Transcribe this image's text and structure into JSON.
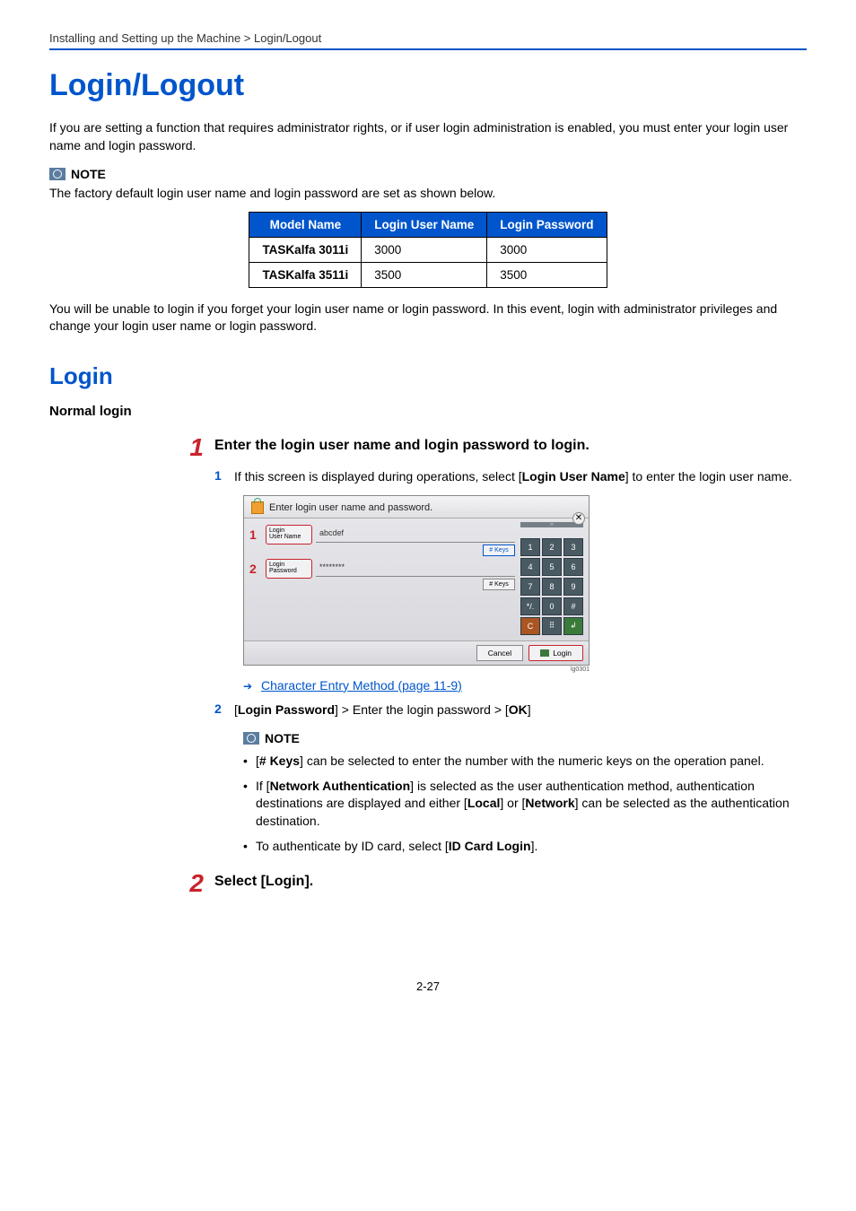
{
  "breadcrumb": "Installing and Setting up the Machine > Login/Logout",
  "h1": "Login/Logout",
  "intro": "If you are setting a function that requires administrator rights, or if user login administration is enabled, you must enter your login user name and login password.",
  "note_label": "NOTE",
  "note1_text": "The factory default login user name and login password are set as shown below.",
  "table": {
    "headers": [
      "Model Name",
      "Login User Name",
      "Login Password"
    ],
    "rows": [
      [
        "TASKalfa 3011i",
        "3000",
        "3000"
      ],
      [
        "TASKalfa 3511i",
        "3500",
        "3500"
      ]
    ]
  },
  "after_table": "You will be unable to login if you forget your login user name or login password. In this event, login with administrator privileges and change your login user name or login password.",
  "h2": "Login",
  "h3": "Normal login",
  "step1": {
    "num": "1",
    "title": "Enter the login user name and login password to login.",
    "sub1_num": "1",
    "sub1_a": "If this screen is displayed during operations, select [",
    "sub1_b": "Login User Name",
    "sub1_c": "] to enter the login user name.",
    "link": "Character Entry Method (page 11-9)",
    "sub2_num": "2",
    "sub2_a": "[",
    "sub2_b": "Login Password",
    "sub2_c": "] > Enter the login password > [",
    "sub2_d": "OK",
    "sub2_e": "]",
    "note_items": {
      "i1a": "[",
      "i1b": "# Keys",
      "i1c": "] can be selected to enter the number with the numeric keys on the operation panel.",
      "i2a": "If [",
      "i2b": "Network Authentication",
      "i2c": "] is selected as the user authentication method, authentication destinations are displayed and either [",
      "i2d": "Local",
      "i2e": "] or [",
      "i2f": "Network",
      "i2g": "] can be selected as the authentication destination.",
      "i3a": "To authenticate by ID card, select [",
      "i3b": "ID Card Login",
      "i3c": "]."
    }
  },
  "step2": {
    "num": "2",
    "title": "Select [Login]."
  },
  "shot": {
    "title": "Enter login user name and password.",
    "marker1": "1",
    "marker2": "2",
    "label_user": "Login\nUser Name",
    "label_pass": "Login\nPassword",
    "val_user": "abcdef",
    "val_pass": "********",
    "keys_btn": "# Keys",
    "cancel": "Cancel",
    "login": "Login",
    "keypad": [
      "1",
      "2",
      "3",
      "4",
      "5",
      "6",
      "7",
      "8",
      "9",
      "*/.",
      "0",
      "#",
      "C",
      "⠿",
      "↲"
    ],
    "id": "lg0301"
  },
  "page_num": "2-27"
}
